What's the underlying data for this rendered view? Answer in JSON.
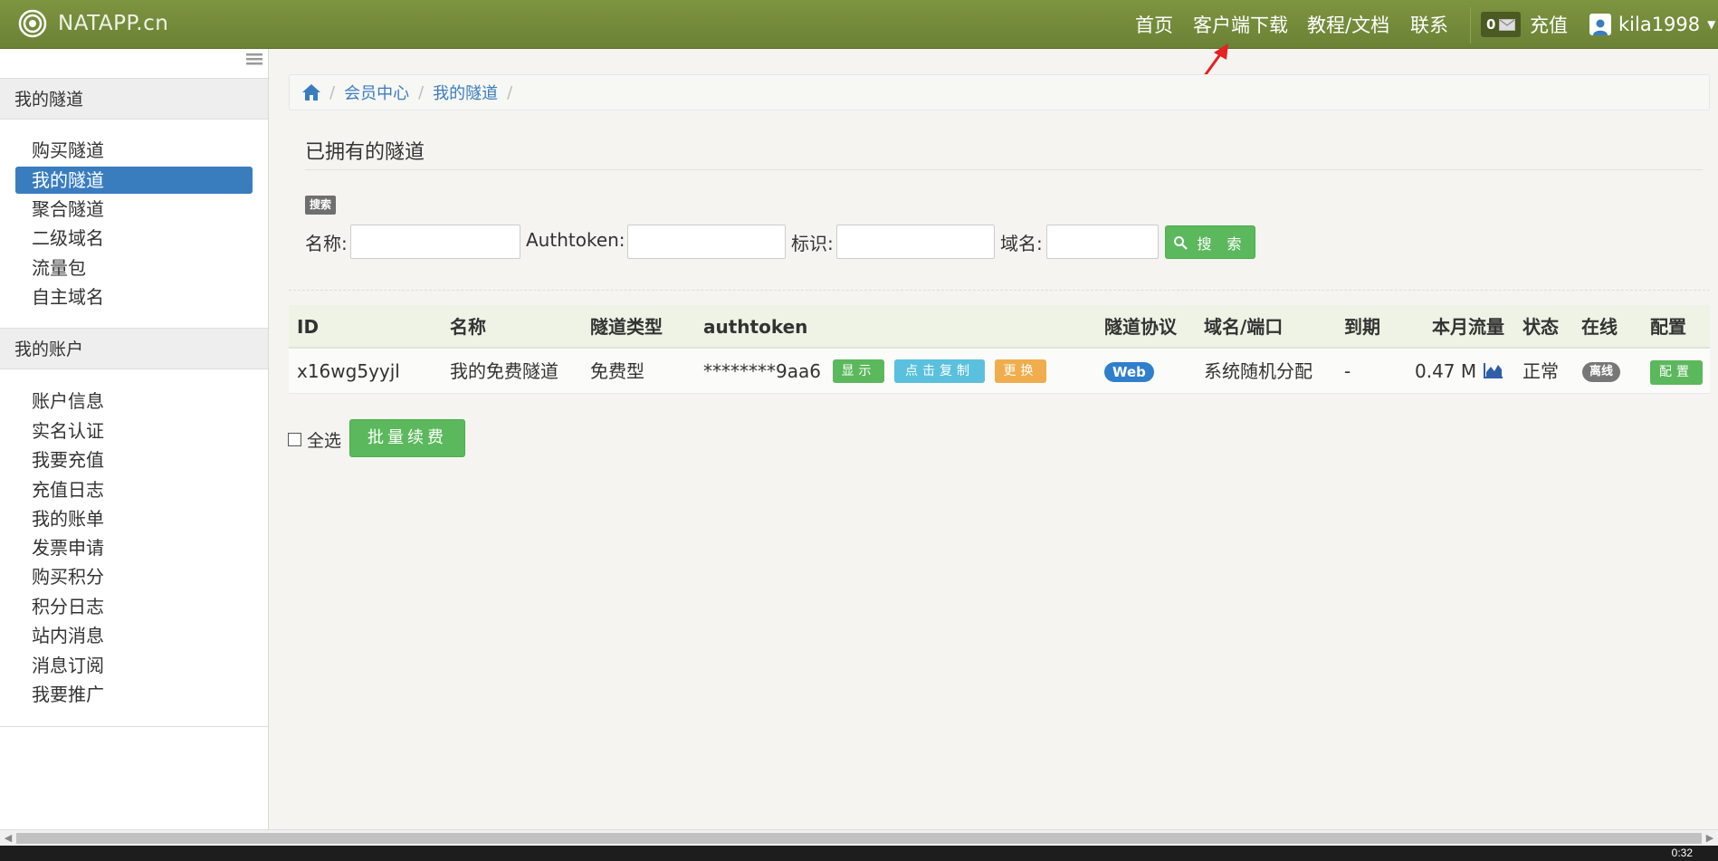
{
  "brand": {
    "name": "NATAPP.cn"
  },
  "nav": {
    "home": "首页",
    "client_download": "客户端下载",
    "docs": "教程/文档",
    "contact": "联系",
    "message_count": "0",
    "recharge": "充值",
    "username": "kila1998"
  },
  "sidebar": {
    "section1": "我的隧道",
    "tunnel_items": [
      "购买隧道",
      "我的隧道",
      "聚合隧道",
      "二级域名",
      "流量包",
      "自主域名"
    ],
    "section2": "我的账户",
    "account_items": [
      "账户信息",
      "实名认证",
      "我要充值",
      "充值日志",
      "我的账单",
      "发票申请",
      "购买积分",
      "积分日志",
      "站内消息",
      "消息订阅",
      "我要推广"
    ]
  },
  "breadcrumb": [
    "会员中心",
    "我的隧道"
  ],
  "page": {
    "title": "已拥有的隧道",
    "search_tag": "搜索"
  },
  "search": {
    "name_label": "名称:",
    "authtoken_label": "Authtoken:",
    "tag_label": "标识:",
    "domain_label": "域名:",
    "button": "搜 索"
  },
  "table": {
    "headers": [
      "ID",
      "名称",
      "隧道类型",
      "authtoken",
      "隧道协议",
      "域名/端口",
      "到期",
      "本月流量",
      "状态",
      "在线",
      "配置"
    ],
    "rows": [
      {
        "id": "x16wg5yyjl",
        "name": "我的免费隧道",
        "type": "免费型",
        "authtoken": "********9aa6",
        "show_btn": "显示",
        "copy_btn": "点击复制",
        "change_btn": "更换",
        "protocol": "Web",
        "domain": "系统随机分配",
        "expire": "-",
        "traffic": "0.47 M",
        "status": "正常",
        "online": "离线",
        "config_btn": "配置"
      }
    ]
  },
  "footer": {
    "select_all": "全选",
    "batch_renew": "批量续费"
  },
  "taskbar": {
    "clock": "0:32"
  },
  "colors": {
    "navbar": "#6b8235",
    "active_item": "#3a7dbf",
    "green_button": "#5cb85c",
    "show_btn": "#5cb85c",
    "copy_btn": "#5bc0de",
    "change_btn": "#f0ad4e",
    "web_badge": "#2f7fcd",
    "annotation_arrow": "#e52121"
  }
}
